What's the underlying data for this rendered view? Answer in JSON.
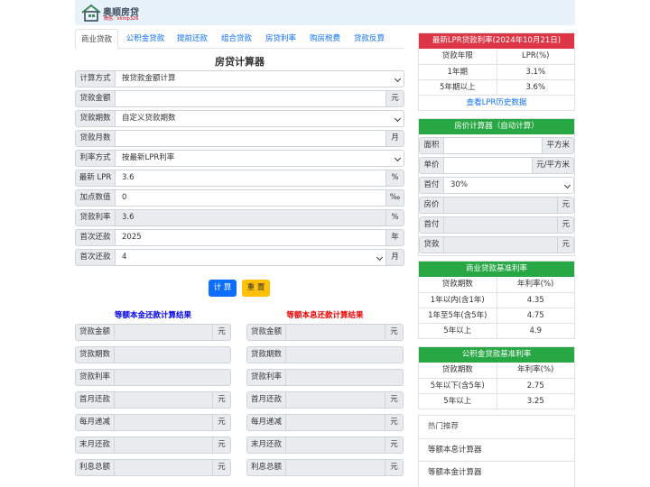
{
  "header": {
    "logo_title": "奥顺房贷",
    "logo_sub": "微信：kkmp326"
  },
  "tabs": [
    "商业贷款",
    "公积金贷款",
    "提前还款",
    "组合贷款",
    "房贷利率",
    "购房税费",
    "贷款反算"
  ],
  "calc": {
    "title": "房贷计算器",
    "rows": [
      {
        "label": "计算方式",
        "value": "按贷款金额计算",
        "unit": ""
      },
      {
        "label": "贷款金额",
        "value": "",
        "unit": "元"
      },
      {
        "label": "贷款期数",
        "value": "自定义贷款期数",
        "unit": ""
      },
      {
        "label": "贷款月数",
        "value": "",
        "unit": "月"
      },
      {
        "label": "利率方式",
        "value": "按最新LPR利率",
        "unit": ""
      },
      {
        "label": "最新 LPR",
        "value": "3.6",
        "unit": "%"
      },
      {
        "label": "加点数值",
        "value": "0",
        "unit": "‰"
      },
      {
        "label": "贷款利率",
        "value": "3.6",
        "unit": "%"
      },
      {
        "label": "首次还款",
        "value": "2025",
        "unit": "年"
      },
      {
        "label": "首次还款",
        "value": "4",
        "unit": "月"
      }
    ],
    "btn_calc": "计 算",
    "btn_reset": "重 置"
  },
  "results": {
    "left_title": "等额本金还款计算结果",
    "right_title": "等额本息还款计算结果",
    "left": [
      {
        "label": "贷款金额",
        "unit": "元"
      },
      {
        "label": "贷款期数",
        "unit": ""
      },
      {
        "label": "贷款利率",
        "unit": ""
      },
      {
        "label": "首月还款",
        "unit": "元"
      },
      {
        "label": "每月递减",
        "unit": "元"
      },
      {
        "label": "末月还款",
        "unit": "元"
      },
      {
        "label": "利息总额",
        "unit": "元"
      }
    ],
    "right": [
      {
        "label": "贷款金额",
        "unit": "元"
      },
      {
        "label": "贷款期数",
        "unit": ""
      },
      {
        "label": "贷款利率",
        "unit": ""
      },
      {
        "label": "首月还款",
        "unit": "元"
      },
      {
        "label": "每月递减",
        "unit": "元"
      },
      {
        "label": "末月还款",
        "unit": "元"
      },
      {
        "label": "利息总额",
        "unit": "元"
      }
    ]
  },
  "lpr": {
    "title": "最新LPR贷款利率(2024年10月21日)",
    "head": [
      "贷款年限",
      "LPR(%)"
    ],
    "rows": [
      [
        "1年期",
        "3.1%"
      ],
      [
        "5年期以上",
        "3.6%"
      ]
    ],
    "link": "查看LPR历史数据"
  },
  "price": {
    "title": "房价计算器（自动计算）",
    "rows": [
      {
        "label": "面积",
        "value": "",
        "unit": "平方米"
      },
      {
        "label": "单价",
        "value": "",
        "unit": "元/平方米"
      },
      {
        "label": "首付",
        "value": "30%",
        "unit": ""
      },
      {
        "label": "房价",
        "value": "",
        "unit": "元"
      },
      {
        "label": "首付",
        "value": "",
        "unit": "元"
      },
      {
        "label": "贷款",
        "value": "",
        "unit": "元"
      }
    ]
  },
  "commercial": {
    "title": "商业贷款基准利率",
    "head": [
      "贷款期数",
      "年利率(%)"
    ],
    "rows": [
      [
        "1年以内(含1年)",
        "4.35"
      ],
      [
        "1年至5年(含5年)",
        "4.75"
      ],
      [
        "5年以上",
        "4.9"
      ]
    ]
  },
  "fund": {
    "title": "公积金贷款基准利率",
    "head": [
      "贷款期数",
      "年利率(%)"
    ],
    "rows": [
      [
        "5年以下(含5年)",
        "2.75"
      ],
      [
        "5年以上",
        "3.25"
      ]
    ]
  },
  "hot": {
    "title": "热门推荐",
    "items": [
      "等额本息计算器",
      "等额本金计算器"
    ]
  },
  "colors": {
    "red": "#dc3545",
    "green": "#28a745",
    "blue": "#0d6efd",
    "yellow": "#ffc107"
  }
}
